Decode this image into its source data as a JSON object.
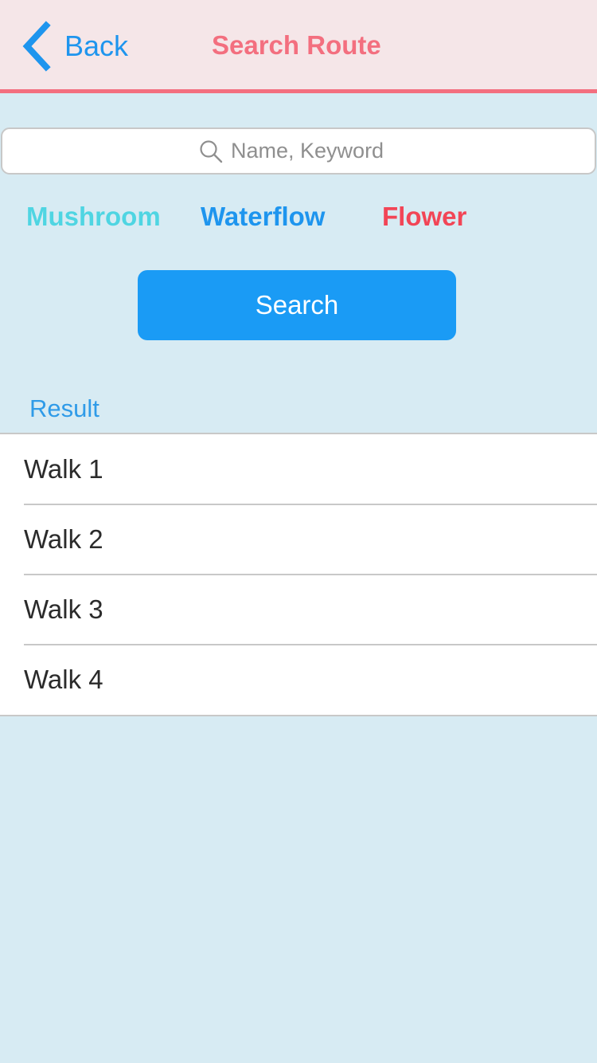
{
  "nav": {
    "back_label": "Back",
    "title": "Search Route"
  },
  "search": {
    "placeholder": "Name, Keyword",
    "value": ""
  },
  "filters": [
    {
      "label": "Mushroom",
      "color": "#4fd5e2"
    },
    {
      "label": "Waterflow",
      "color": "#1e95ee"
    },
    {
      "label": "Flower",
      "color": "#f24556"
    }
  ],
  "search_button_label": "Search",
  "results": {
    "header": "Result",
    "items": [
      {
        "label": "Walk 1"
      },
      {
        "label": "Walk 2"
      },
      {
        "label": "Walk 3"
      },
      {
        "label": "Walk 4"
      }
    ]
  },
  "icons": {
    "back": "chevron-left-icon",
    "search": "magnifier-icon"
  },
  "colors": {
    "background": "#d7ebf3",
    "nav_background": "#f5e6e8",
    "accent_pink": "#f36f7f",
    "accent_blue": "#1e95ee",
    "button_blue": "#1a9bf5"
  }
}
